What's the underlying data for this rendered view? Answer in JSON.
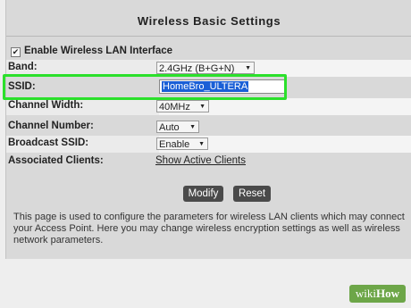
{
  "page": {
    "title": "Wireless Basic Settings"
  },
  "enable_wireless": {
    "label": "Enable Wireless LAN Interface",
    "checked": true
  },
  "band": {
    "label": "Band:",
    "value": "2.4GHz (B+G+N)"
  },
  "ssid": {
    "label": "SSID:",
    "value": "HomeBro_ULTERA"
  },
  "channel_width": {
    "label": "Channel Width:",
    "value": "40MHz"
  },
  "channel_number": {
    "label": "Channel Number:",
    "value": "Auto"
  },
  "broadcast_ssid": {
    "label": "Broadcast SSID:",
    "value": "Enable"
  },
  "associated_clients": {
    "label": "Associated Clients:",
    "link": "Show Active Clients"
  },
  "buttons": {
    "modify": "Modify",
    "reset": "Reset"
  },
  "description": [
    "This page is used to configure the parameters for wireless LAN clients which may connect",
    "your Access Point. Here you may change wireless encryption settings as well as wireless",
    "network parameters."
  ],
  "watermark": {
    "wiki": "wiki",
    "how": "How"
  },
  "colors": {
    "highlight": "#2be02b",
    "selection": "#1a5fd6",
    "button": "#4a4a4a"
  }
}
